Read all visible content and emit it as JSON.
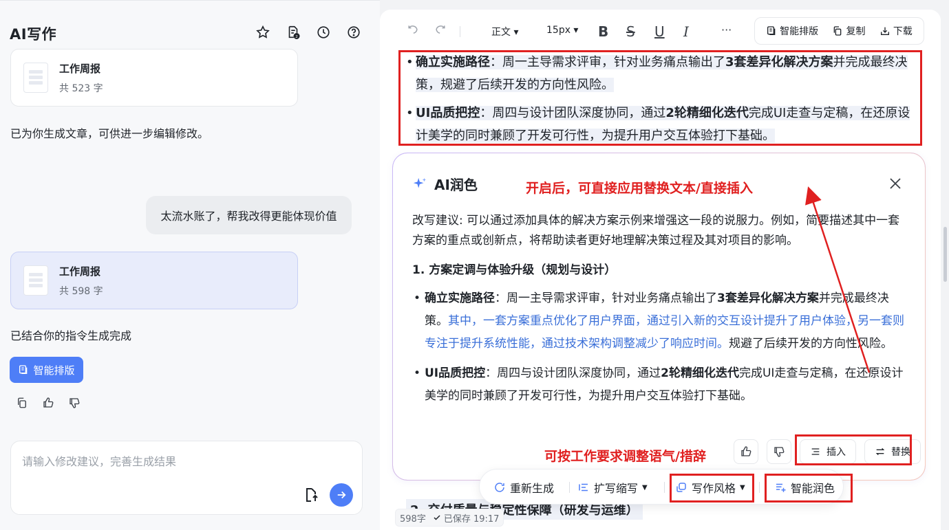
{
  "left": {
    "title": "AI写作",
    "icons": [
      "star-icon",
      "doc-badge-icon",
      "history-icon",
      "help-icon"
    ],
    "doc_cards": [
      {
        "title": "工作周报",
        "count": "共 523 字"
      },
      {
        "title": "工作周报",
        "count": "共 598 字"
      }
    ],
    "msg_generated": "已为你生成文章，可供进一步编辑修改。",
    "user_message": "太流水账了，帮我改得更能体现价值",
    "msg_done": "已结合你的指令生成完成",
    "smart_layout_btn": "智能排版",
    "input_placeholder": "请输入修改建议，完善生成结果"
  },
  "toolbar": {
    "paragraph_style": "正文 ▾",
    "font_size": "15px ▾",
    "bold": "B",
    "strike": "S",
    "underline": "U",
    "italic": "I",
    "more": "···",
    "smart_layout": "智能排版",
    "copy": "复制",
    "download": "下载"
  },
  "doc": {
    "b1_label": "确立实施路径",
    "b1_pre": "：周一主导需求评审，针对业务痛点输出了",
    "b1_bold": "3套差异化解决方案",
    "b1_post": "并完成最终决策，规避了后续开发的方向性风险。",
    "b2_label": "UI品质把控",
    "b2_pre": "：周四与设计团队深度协同，通过",
    "b2_bold": "2轮精细化迭代",
    "b2_post": "完成UI走查与定稿，在还原设计美学的同时兼顾了开发可行性，为提升用户交互体验打下基础。",
    "section2": "2. 交付质量与稳定性保障（研发与运维）"
  },
  "ai_card": {
    "title": "AI润色",
    "suggestion": "改写建议: 可以通过添加具体的解决方案示例来增强这一段的说服力。例如，简要描述其中一套方案的重点或创新点，将帮助读者更好地理解决策过程及其对项目的影响。",
    "section": "1. 方案定调与体验升级（规划与设计）",
    "b1_label": "确立实施路径",
    "b1_pre": "：周一主导需求评审，针对业务痛点输出了",
    "b1_bold": "3套差异化解决方案",
    "b1_mid": "并完成最终决策。",
    "b1_blue": "其中，一套方案重点优化了用户界面，通过引入新的交互设计提升了用户体验，另一套则专注于提升系统性能，通过技术架构调整减少了响应时间。",
    "b1_post": "规避了后续开发的方向性风险。",
    "b2_label": "UI品质把控",
    "b2_pre": "：周四与设计团队深度协同，通过",
    "b2_bold": "2轮精细化迭代",
    "b2_post": "完成UI走查与定稿，在还原设计美学的同时兼顾了开发可行性，为提升用户交互体验打下基础。",
    "insert": "插入",
    "replace": "替换"
  },
  "float_bar": {
    "regenerate": "重新生成",
    "expand": "扩写缩写",
    "style": "写作风格",
    "polish": "智能润色"
  },
  "status": {
    "words": "598字",
    "saved": "已保存 19:17"
  },
  "annotations": {
    "top": "开启后，可直接应用替换文本/直接插入",
    "bottom": "可按工作要求调整语气/措辞"
  },
  "colors": {
    "accent": "#4e7ef7",
    "annotation": "#e02020",
    "blue_text": "#3a6fd8"
  }
}
